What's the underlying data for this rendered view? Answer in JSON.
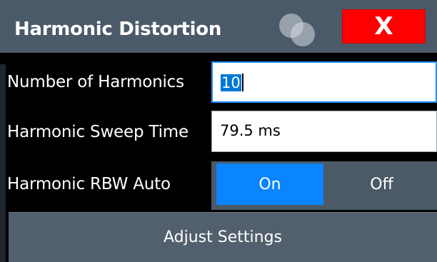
{
  "dialog": {
    "title": "Harmonic Distortion",
    "close_label": "X"
  },
  "fields": {
    "harmonics": {
      "label": "Number of Harmonics",
      "value": "10"
    },
    "sweep_time": {
      "label": "Harmonic Sweep Time",
      "value": "79.5 ms"
    },
    "rbw_auto": {
      "label": "Harmonic RBW Auto",
      "on_label": "On",
      "off_label": "Off",
      "selected": "On"
    }
  },
  "actions": {
    "adjust_label": "Adjust Settings"
  },
  "colors": {
    "title_bar": "#4a5a69",
    "close_button": "#ff0000",
    "toggle_on": "#0a84ff",
    "active_field_border": "#1e90ff"
  },
  "icons": {
    "logo": "overlapping-circles-logo-icon",
    "close": "close-icon"
  }
}
